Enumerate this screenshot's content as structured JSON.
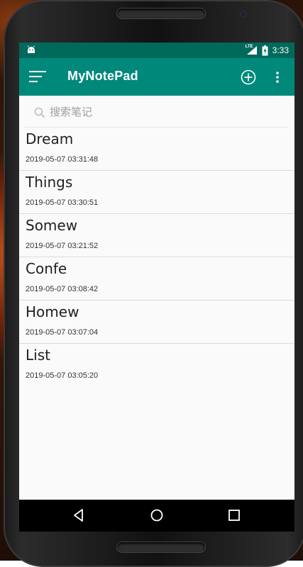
{
  "status_bar": {
    "network_label": "LTE",
    "time": "3:33"
  },
  "app_bar": {
    "title": "MyNotePad",
    "icons": [
      "menu-icon",
      "add-circle-icon",
      "more-vert-icon"
    ]
  },
  "search": {
    "placeholder": "搜索笔记",
    "value": ""
  },
  "notes": [
    {
      "title": "Dream",
      "date": "2019-05-07 03:31:48"
    },
    {
      "title": "Things",
      "date": "2019-05-07 03:30:51"
    },
    {
      "title": "Somew",
      "date": "2019-05-07 03:21:52"
    },
    {
      "title": "Confe",
      "date": "2019-05-07 03:08:42"
    },
    {
      "title": "Homew",
      "date": "2019-05-07 03:07:04"
    },
    {
      "title": "List",
      "date": "2019-05-07 03:05:20"
    }
  ],
  "nav_bar": {
    "icons": [
      "back-icon",
      "home-icon",
      "recents-icon"
    ]
  },
  "colors": {
    "status_bar": "#00695c",
    "app_bar": "#00897b",
    "background": "#fafafa"
  }
}
